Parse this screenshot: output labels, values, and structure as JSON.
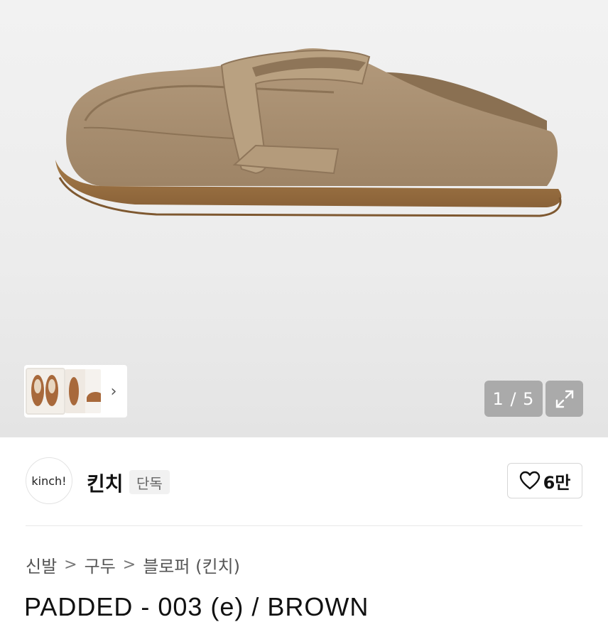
{
  "gallery": {
    "counter": "1 / 5",
    "thumb_next_icon": "chevron-right-icon",
    "expand_icon": "expand-icon"
  },
  "brand": {
    "logo_text": "kinch!",
    "name": "킨치",
    "badge": "단독",
    "like_count": "6만",
    "like_icon": "heart-outline-icon"
  },
  "breadcrumb": {
    "items": [
      "신발",
      "구두",
      "블로퍼 (킨치)"
    ],
    "separator": ">"
  },
  "product": {
    "title": "PADDED - 003 (e) / BROWN"
  },
  "colors": {
    "suede": "#a98f70",
    "sole": "#9b7444",
    "counter_bg": "#969696"
  }
}
